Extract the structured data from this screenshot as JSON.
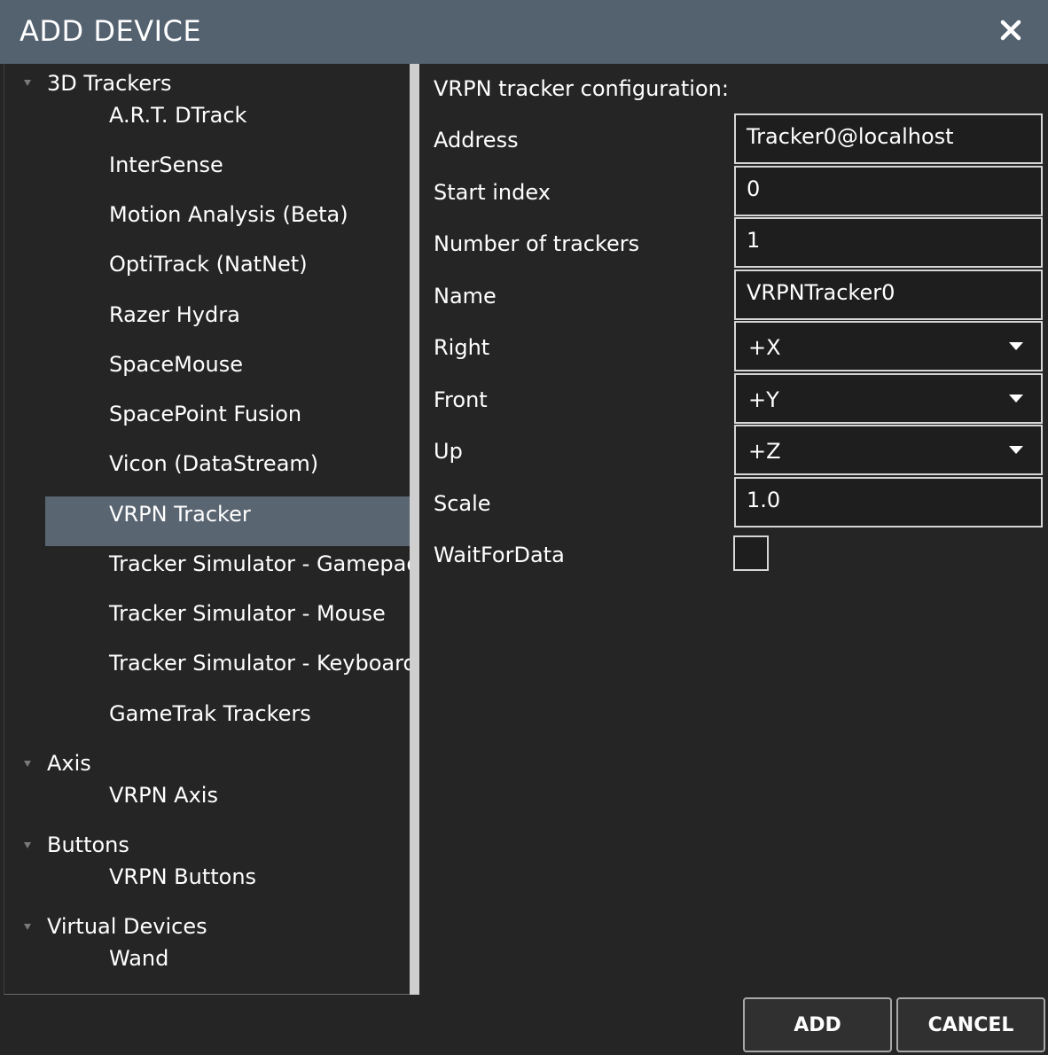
{
  "window": {
    "title": "ADD DEVICE"
  },
  "tree": {
    "categories": [
      {
        "label": "3D Trackers",
        "items": [
          "A.R.T. DTrack",
          "InterSense",
          "Motion Analysis (Beta)",
          "OptiTrack (NatNet)",
          "Razer Hydra",
          "SpaceMouse",
          "SpacePoint Fusion",
          "Vicon (DataStream)",
          "VRPN Tracker",
          "Tracker Simulator - Gamepad",
          "Tracker Simulator - Mouse",
          "Tracker Simulator - Keyboard",
          "GameTrak Trackers"
        ]
      },
      {
        "label": "Axis",
        "items": [
          "VRPN Axis"
        ]
      },
      {
        "label": "Buttons",
        "items": [
          "VRPN Buttons"
        ]
      },
      {
        "label": "Virtual Devices",
        "items": [
          "Wand"
        ]
      }
    ],
    "selected": "VRPN Tracker"
  },
  "config": {
    "heading": "VRPN tracker configuration:",
    "fields": [
      {
        "label": "Address",
        "value": "Tracker0@localhost",
        "kind": "text"
      },
      {
        "label": "Start index",
        "value": "0",
        "kind": "text"
      },
      {
        "label": "Number of trackers",
        "value": "1",
        "kind": "text"
      },
      {
        "label": "Name",
        "value": "VRPNTracker0",
        "kind": "text"
      },
      {
        "label": "Right",
        "value": "+X",
        "kind": "select"
      },
      {
        "label": "Front",
        "value": "+Y",
        "kind": "select"
      },
      {
        "label": "Up",
        "value": "+Z",
        "kind": "select"
      },
      {
        "label": "Scale",
        "value": "1.0",
        "kind": "text"
      }
    ],
    "checkbox": {
      "label": "WaitForData",
      "checked": false
    }
  },
  "buttons": {
    "add": "ADD",
    "cancel": "CANCEL"
  },
  "icons": {
    "close": "close-icon",
    "expand": "expanded-arrow-icon",
    "dropdown": "chevron-down-icon"
  },
  "colors": {
    "titlebar": "#546270",
    "background": "#252526",
    "selection": "#5a6572"
  }
}
